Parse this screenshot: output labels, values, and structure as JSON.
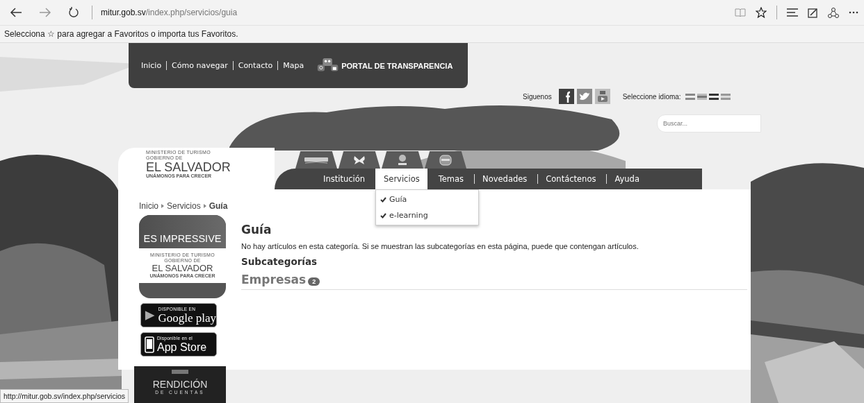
{
  "browser": {
    "url_host": "mitur.gob.sv",
    "url_path": "/index.php/servicios/guia",
    "favorites_hint": "Selecciona ☆ para agregar a Favoritos o importa tus Favoritos."
  },
  "top_nav": {
    "links": [
      "Inicio",
      "Cómo navegar",
      "Contacto",
      "Mapa"
    ],
    "portal": "PORTAL DE TRANSPARENCIA"
  },
  "social": {
    "label": "Siguenos",
    "language_label": "Seleccione idioma:"
  },
  "search": {
    "placeholder": "Buscar..."
  },
  "logo": {
    "ministry": "MINISTERIO DE TURISMO",
    "government": "GOBIERNO DE",
    "country": "EL SALVADOR",
    "slogan": "UNÁMONOS PARA CRECER"
  },
  "main_nav": [
    {
      "label": "Institución",
      "selected": false
    },
    {
      "label": "Servicios",
      "selected": true
    },
    {
      "label": "Temas",
      "selected": false
    },
    {
      "label": "Novedades",
      "selected": false
    },
    {
      "label": "Contáctenos",
      "selected": false
    },
    {
      "label": "Ayuda",
      "selected": false
    }
  ],
  "dropdown": [
    {
      "label": "Guía"
    },
    {
      "label": "e-learning"
    }
  ],
  "breadcrumb": [
    "Inicio",
    "Servicios",
    "Guía"
  ],
  "sidebar": {
    "impressive": {
      "title": "ES IMPRESSIVE",
      "ministry": "MINISTERIO DE TURISMO",
      "government": "GOBIERNO DE",
      "country": "EL SALVADOR",
      "slogan": "UNÁMONOS PARA CRECER"
    },
    "google_play": {
      "top": "DISPONIBLE EN",
      "name": "Google play"
    },
    "app_store": {
      "top": "Disponible en el",
      "name": "App Store"
    },
    "rendicion": {
      "title": "RENDICIÓN",
      "subtitle": "DE CUENTAS"
    }
  },
  "content": {
    "title": "Guía",
    "message": "No hay artículos en esta categoría. Si se muestran las subcategorías en esta página, puede que contengan artículos.",
    "subheading": "Subcategorías",
    "categories": [
      {
        "name": "Empresas",
        "count": "2"
      }
    ]
  },
  "status_url": "http://mitur.gob.sv/index.php/servicios"
}
